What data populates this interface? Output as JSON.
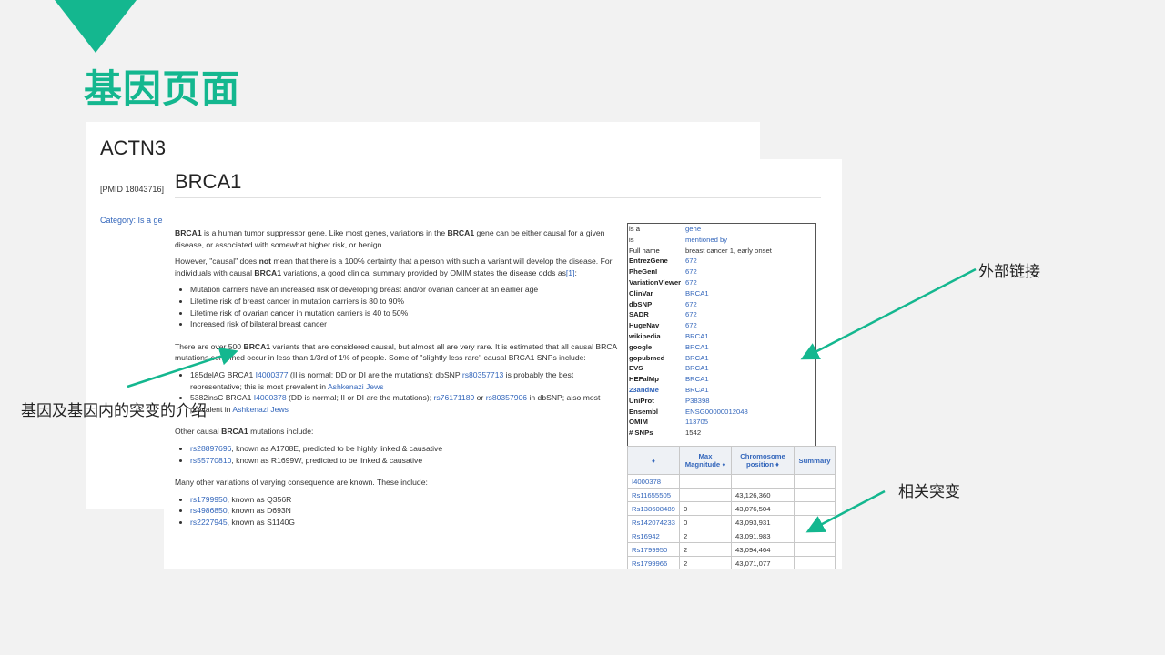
{
  "slide": {
    "title": "基因页面"
  },
  "actn3": {
    "title": "ACTN3",
    "pmid": "[PMID 18043716]",
    "category": "Category:  Is a ge"
  },
  "brca1": {
    "title": "BRCA1",
    "para1": [
      {
        "t": "BRCA1",
        "b": true
      },
      {
        "t": " is a human tumor suppressor gene. Like most genes, variations in the "
      },
      {
        "t": "BRCA1",
        "b": true
      },
      {
        "t": " gene can be either causal for a given disease, or associated with somewhat higher risk, or benign."
      }
    ],
    "para2": [
      {
        "t": "However, \"causal\" does "
      },
      {
        "t": "not",
        "b": true
      },
      {
        "t": " mean that there is a 100% certainty that a person with such a variant will develop the disease. For individuals with causal "
      },
      {
        "t": "BRCA1",
        "b": true
      },
      {
        "t": " variations, a good clinical summary provided by OMIM states the disease odds as"
      },
      {
        "t": "[1]",
        "l": true
      },
      {
        "t": ":"
      }
    ],
    "risks": [
      "Mutation carriers have an increased risk of developing breast and/or ovarian cancer at an earlier age",
      "Lifetime risk of breast cancer in mutation carriers is 80 to 90%",
      "Lifetime risk of ovarian cancer in mutation carriers is 40 to 50%",
      "Increased risk of bilateral breast cancer"
    ],
    "para3": [
      {
        "t": "There are over 500 "
      },
      {
        "t": "BRCA1",
        "b": true
      },
      {
        "t": " variants that are considered causal, but almost all are very rare. It is estimated that all causal BRCA mutations combined occur in less than 1/3rd of 1% of people. Some of \"slightly less rare\" causal BRCA1 SNPs include:"
      }
    ],
    "causal_snps": [
      [
        {
          "t": "185delAG BRCA1 "
        },
        {
          "t": "I4000377",
          "l": true
        },
        {
          "t": " (II is normal; DD or DI are the mutations); dbSNP "
        },
        {
          "t": "rs80357713",
          "l": true
        },
        {
          "t": " is probably the best representative; this is most prevalent in "
        },
        {
          "t": "Ashkenazi Jews",
          "l": true
        }
      ],
      [
        {
          "t": "5382insC BRCA1 "
        },
        {
          "t": "I4000378",
          "l": true
        },
        {
          "t": " (DD is normal; II or DI are the mutations); "
        },
        {
          "t": "rs76171189",
          "l": true
        },
        {
          "t": " or "
        },
        {
          "t": "rs80357906",
          "l": true
        },
        {
          "t": " in dbSNP; also most prevalent in "
        },
        {
          "t": "Ashkenazi Jews",
          "l": true
        }
      ]
    ],
    "para4": [
      {
        "t": "Other causal "
      },
      {
        "t": "BRCA1",
        "b": true
      },
      {
        "t": " mutations include:"
      }
    ],
    "other_mutations": [
      [
        {
          "t": "rs28897696",
          "l": true
        },
        {
          "t": ", known as A1708E, predicted to be highly linked & causative"
        }
      ],
      [
        {
          "t": "rs55770810",
          "l": true
        },
        {
          "t": ", known as R1699W, predicted to be linked & causative"
        }
      ]
    ],
    "para5": [
      {
        "t": "Many other variations of varying consequence are known. These include:"
      }
    ],
    "variations": [
      [
        {
          "t": "rs1799950",
          "l": true
        },
        {
          "t": ", known as Q356R"
        }
      ],
      [
        {
          "t": "rs4986850",
          "l": true
        },
        {
          "t": ", known as D693N"
        }
      ],
      [
        {
          "t": "rs2227945",
          "l": true
        },
        {
          "t": ", known as S1140G"
        }
      ]
    ],
    "infobox": [
      {
        "k": "is a",
        "v": "gene",
        "kb": false,
        "vlink": true
      },
      {
        "k": "is",
        "v": "mentioned by",
        "kb": false,
        "vlink": true
      },
      {
        "k": "Full name",
        "v": "breast cancer 1, early onset",
        "kb": false,
        "vlink": false
      },
      {
        "k": "EntrezGene",
        "v": "672",
        "kb": true,
        "vlink": true
      },
      {
        "k": "PheGenI",
        "v": "672",
        "kb": true,
        "vlink": true
      },
      {
        "k": "VariationViewer",
        "v": "672",
        "kb": true,
        "vlink": true
      },
      {
        "k": "ClinVar",
        "v": "BRCA1",
        "kb": true,
        "vlink": true
      },
      {
        "k": "dbSNP",
        "v": "672",
        "kb": true,
        "vlink": true
      },
      {
        "k": "SADR",
        "v": "672",
        "kb": true,
        "vlink": true
      },
      {
        "k": "HugeNav",
        "v": "672",
        "kb": true,
        "vlink": true
      },
      {
        "k": "wikipedia",
        "v": "BRCA1",
        "kb": true,
        "vlink": true
      },
      {
        "k": "google",
        "v": "BRCA1",
        "kb": true,
        "vlink": true
      },
      {
        "k": "gopubmed",
        "v": "BRCA1",
        "kb": true,
        "vlink": true
      },
      {
        "k": "EVS",
        "v": "BRCA1",
        "kb": true,
        "vlink": true
      },
      {
        "k": "HEFalMp",
        "v": "BRCA1",
        "kb": true,
        "vlink": true
      },
      {
        "k": "23andMe",
        "v": "BRCA1",
        "kb": true,
        "vlink": true,
        "klink": true
      },
      {
        "k": "UniProt",
        "v": "P38398",
        "kb": true,
        "vlink": true
      },
      {
        "k": "Ensembl",
        "v": "ENSG00000012048",
        "kb": true,
        "vlink": true
      },
      {
        "k": "OMIM",
        "v": "113705",
        "kb": true,
        "vlink": true
      },
      {
        "k": "# SNPs",
        "v": "1542",
        "kb": true,
        "vlink": false
      }
    ],
    "snp_table": {
      "headers": [
        "",
        "Max Magnitude",
        "Chromosome position",
        "Summary"
      ],
      "rows": [
        [
          "I4000378",
          "",
          "",
          ""
        ],
        [
          "Rs11655505",
          "",
          "43,126,360",
          ""
        ],
        [
          "Rs138608489",
          "0",
          "43,076,504",
          ""
        ],
        [
          "Rs142074233",
          "0",
          "43,093,931",
          ""
        ],
        [
          "Rs16942",
          "2",
          "43,091,983",
          ""
        ],
        [
          "Rs1799950",
          "2",
          "43,094,464",
          ""
        ],
        [
          "Rs1799966",
          "2",
          "43,071,077",
          ""
        ]
      ]
    }
  },
  "annotations": {
    "external_links": "外部链接",
    "gene_intro": "基因及基因内的突变的介绍",
    "related_mutations": "相关突变"
  },
  "colors": {
    "accent": "#14b78f",
    "link": "#3366bb"
  }
}
